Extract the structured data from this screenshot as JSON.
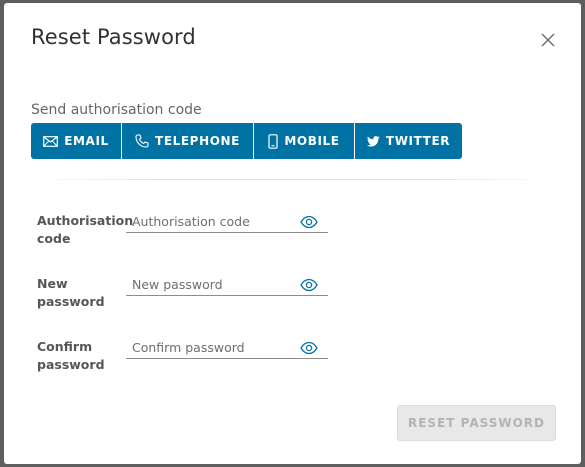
{
  "dialog": {
    "title": "Reset Password"
  },
  "send_code": {
    "label": "Send authorisation code",
    "options": [
      {
        "label": "EMAIL",
        "icon": "envelope-icon"
      },
      {
        "label": "TELEPHONE",
        "icon": "phone-icon"
      },
      {
        "label": "MOBILE",
        "icon": "mobile-icon"
      },
      {
        "label": "TWITTER",
        "icon": "twitter-icon"
      }
    ]
  },
  "form": {
    "auth_code": {
      "label": "Authorisation code",
      "placeholder": "Authorisation code",
      "value": ""
    },
    "new_password": {
      "label": "New password",
      "placeholder": "New password",
      "value": ""
    },
    "confirm_password": {
      "label": "Confirm password",
      "placeholder": "Confirm password",
      "value": ""
    }
  },
  "actions": {
    "reset_label": "RESET PASSWORD"
  },
  "colors": {
    "accent": "#0072a3",
    "eye_icon": "#0072a3",
    "disabled_button_bg": "#e8e8e8",
    "disabled_button_text": "#b3b3b3",
    "overlay": "#5e5e5e"
  }
}
